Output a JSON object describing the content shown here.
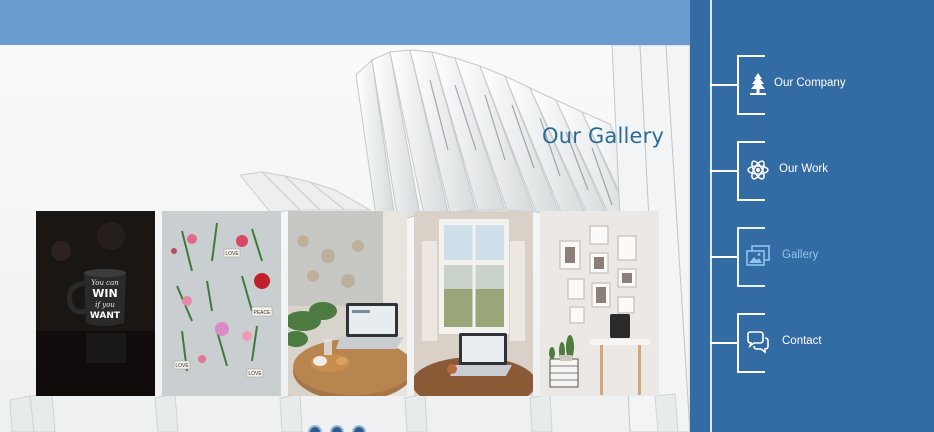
{
  "gallery": {
    "title": "Our Gallery",
    "images": [
      {
        "icon": "mug-photo",
        "text_lines": [
          "You can",
          "WIN",
          "if you",
          "WANT"
        ]
      },
      {
        "icon": "flowers-photo",
        "text_lines": [
          "LOVE",
          "PEACE",
          "LOVE",
          "LOVE"
        ]
      },
      {
        "icon": "laptop-table-photo"
      },
      {
        "icon": "window-laptop-photo"
      },
      {
        "icon": "frames-wall-photo"
      }
    ]
  },
  "nav": {
    "items": [
      {
        "label": "Our Company",
        "icon": "tree-icon",
        "active": false
      },
      {
        "label": "Our Work",
        "icon": "atom-icon",
        "active": false
      },
      {
        "label": "Gallery",
        "icon": "images-icon",
        "active": true
      },
      {
        "label": "Contact",
        "icon": "chat-bubbles-icon",
        "active": false
      }
    ]
  },
  "colors": {
    "top_band": "#6a9ccf",
    "sidebar": "#336ba4",
    "title": "#2a6e97",
    "active_label": "#8ec4ef"
  }
}
